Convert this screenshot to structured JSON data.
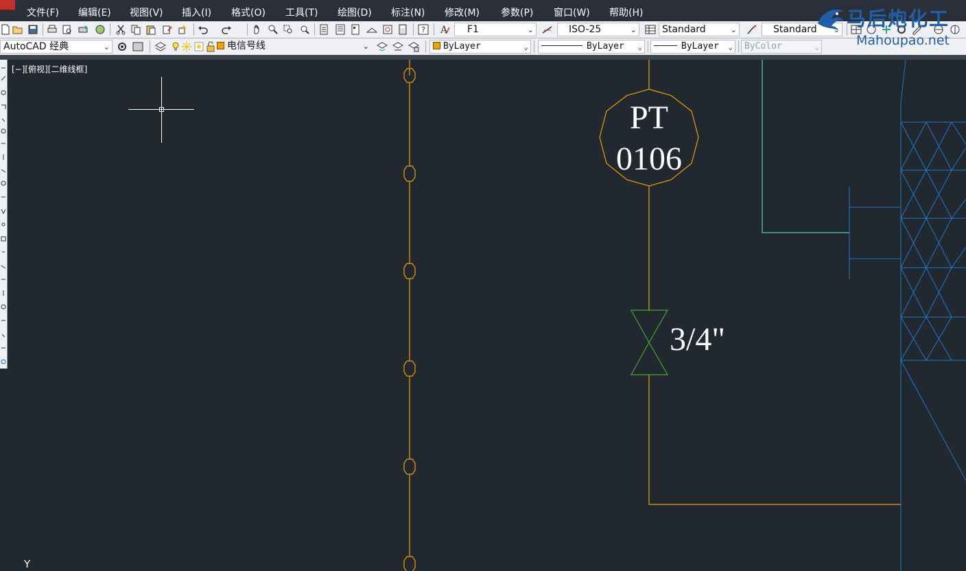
{
  "menu": [
    "文件(F)",
    "编辑(E)",
    "视图(V)",
    "插入(I)",
    "格式(O)",
    "工具(T)",
    "绘图(D)",
    "标注(N)",
    "修改(M)",
    "参数(P)",
    "窗口(W)",
    "帮助(H)"
  ],
  "toolbar1": {
    "text_style": "F1",
    "dim_style": "ISO-25",
    "table_style": "Standard",
    "mleader_style": "Standard"
  },
  "toolbar2": {
    "workspace": "AutoCAD 经典",
    "layer": "电信号线",
    "color": "ByLayer",
    "linetype": "ByLayer",
    "lineweight": "ByLayer",
    "plotstyle": "ByColor"
  },
  "viewport": {
    "label": "[−][俯视][二维线框]"
  },
  "drawing": {
    "instrument_tag_line1": "PT",
    "instrument_tag_line2": "0106",
    "valve_size": "3/4\"",
    "ucs_axis_label": "Y"
  },
  "watermark": {
    "chinese": "马后炮化工",
    "url": "Mahoupao.net"
  },
  "colors": {
    "background": "#212830",
    "signal_line": "#f0a000",
    "valve": "#3fa82e",
    "cyan_line": "#4fd1c5",
    "blue_structure": "#1f78c8",
    "text_white": "#ffffff"
  },
  "icons": {
    "menu": [
      "app-menu-icon"
    ],
    "toolbar1": [
      "new-icon",
      "open-icon",
      "save-icon",
      "plot-icon",
      "plot-preview-icon",
      "publish-icon",
      "3d-print-icon",
      "cut-icon",
      "copy-icon",
      "paste-icon",
      "match-properties-icon",
      "block-editor-icon",
      "undo-icon",
      "redo-icon",
      "pan-icon",
      "zoom-realtime-icon",
      "zoom-window-icon",
      "zoom-previous-icon",
      "properties-icon",
      "design-center-icon",
      "tool-palettes-icon",
      "sheet-set-icon",
      "markup-icon",
      "quickcalc-icon",
      "help-icon",
      "text-style-icon",
      "dim-style-icon",
      "table-style-icon",
      "mleader-style-icon"
    ],
    "toolbar2": [
      "workspace-settings-icon",
      "layer-properties-icon",
      "layer-on-icon",
      "layer-freeze-icon",
      "layer-lock-icon",
      "make-current-icon",
      "layer-previous-icon",
      "layer-state-icon"
    ]
  }
}
